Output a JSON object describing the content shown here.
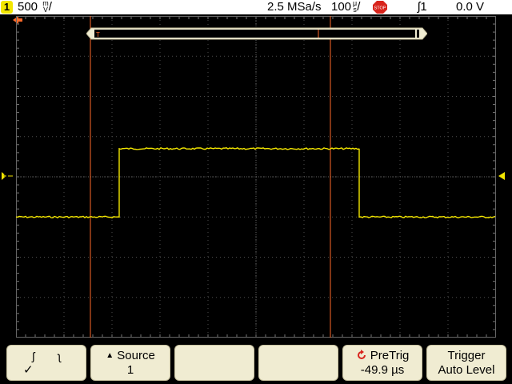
{
  "status": {
    "channel": "1",
    "vertical_scale": "500",
    "vertical_unit_top": "m",
    "vertical_unit_bottom": "V",
    "sample_rate": "2.5 MSa/s",
    "timebase": "100",
    "timebase_unit_top": "μ",
    "timebase_unit_bottom": "s",
    "run_state": "STOP",
    "trigger_source": "1",
    "trigger_level": "0.0 V"
  },
  "colors": {
    "trace": "#f3e600",
    "cursor": "#ff6a2a",
    "grid": "#4a4a4a",
    "softkey_bg": "#f0ecd2"
  },
  "trace": {
    "low_level_div": -1.0,
    "high_level_div": 0.7,
    "rise_time_div": -2.85,
    "fall_time_div": 2.15
  },
  "cursors": {
    "x1_time_div": -3.45,
    "x2_time_div": 1.55
  },
  "softkeys": [
    {
      "id": "slope",
      "line1": "",
      "line2": "✓"
    },
    {
      "id": "source",
      "line1": "Source",
      "line2": "1"
    },
    {
      "id": "blank1",
      "line1": "",
      "line2": ""
    },
    {
      "id": "blank2",
      "line1": "",
      "line2": ""
    },
    {
      "id": "pretrig",
      "line1": "PreTrig",
      "line2": "-49.9 µs"
    },
    {
      "id": "trigger",
      "line1": "Trigger",
      "line2": "Auto Level"
    }
  ]
}
